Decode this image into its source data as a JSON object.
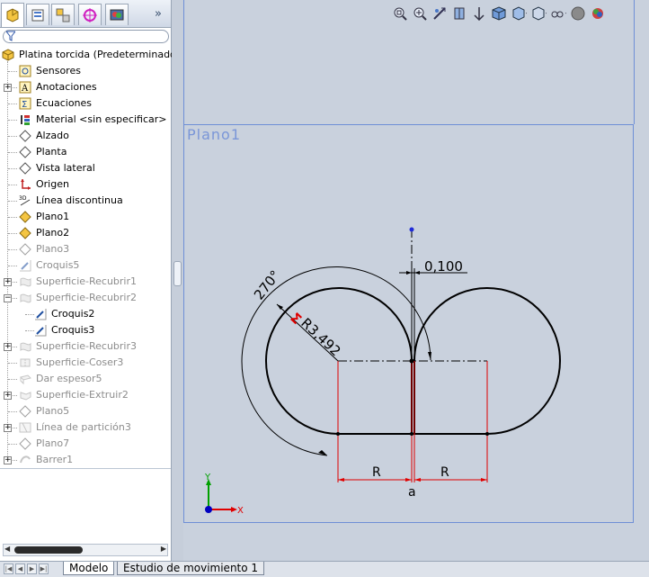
{
  "feature_manager": {
    "filter_icon": "filter-icon",
    "tabs": [
      {
        "name": "feature-manager-tab-icon"
      },
      {
        "name": "property-manager-tab-icon"
      },
      {
        "name": "configuration-manager-tab-icon"
      },
      {
        "name": "dimxpert-tab-icon"
      },
      {
        "name": "display-manager-tab-icon"
      }
    ],
    "collapse_glyph": "»",
    "root": {
      "label": "Platina torcida  (Predeterminado<<",
      "icon": "part-icon"
    },
    "items": [
      {
        "label": "Sensores",
        "icon": "sensor-icon",
        "dim": false,
        "expander": false
      },
      {
        "label": "Anotaciones",
        "icon": "annotation-icon",
        "dim": false,
        "expander": true
      },
      {
        "label": "Ecuaciones",
        "icon": "equation-icon",
        "dim": false,
        "expander": false
      },
      {
        "label": "Material <sin especificar>",
        "icon": "material-icon",
        "dim": false,
        "expander": false
      },
      {
        "label": "Alzado",
        "icon": "plane-icon",
        "dim": false,
        "expander": false
      },
      {
        "label": "Planta",
        "icon": "plane-icon",
        "dim": false,
        "expander": false
      },
      {
        "label": "Vista lateral",
        "icon": "plane-icon",
        "dim": false,
        "expander": false
      },
      {
        "label": "Origen",
        "icon": "origin-icon",
        "dim": false,
        "expander": false
      },
      {
        "label": "Línea discontinua",
        "icon": "3d-sketch-icon",
        "dim": false,
        "expander": false
      },
      {
        "label": "Plano1",
        "icon": "plane-yellow-icon",
        "dim": false,
        "expander": false
      },
      {
        "label": "Plano2",
        "icon": "plane-yellow-icon",
        "dim": false,
        "expander": false
      },
      {
        "label": "Plano3",
        "icon": "plane-icon",
        "dim": true,
        "expander": false
      },
      {
        "label": "Croquis5",
        "icon": "sketch-icon",
        "dim": true,
        "expander": false
      },
      {
        "label": "Superficie-Recubrir1",
        "icon": "surface-loft-icon",
        "dim": true,
        "expander": true
      },
      {
        "label": "Superficie-Recubrir2",
        "icon": "surface-loft-icon",
        "dim": true,
        "expander": true
      },
      {
        "label": "Croquis2",
        "icon": "sketch-icon",
        "dim": false,
        "expander": false,
        "child": true
      },
      {
        "label": "Croquis3",
        "icon": "sketch-icon",
        "dim": false,
        "expander": false,
        "child": true
      },
      {
        "label": "Superficie-Recubrir3",
        "icon": "surface-loft-icon",
        "dim": true,
        "expander": true
      },
      {
        "label": "Superficie-Coser3",
        "icon": "surface-knit-icon",
        "dim": true,
        "expander": false
      },
      {
        "label": "Dar espesor5",
        "icon": "thicken-icon",
        "dim": true,
        "expander": false
      },
      {
        "label": "Superficie-Extruir2",
        "icon": "surface-extrude-icon",
        "dim": true,
        "expander": true
      },
      {
        "label": "Plano5",
        "icon": "plane-icon",
        "dim": true,
        "expander": false
      },
      {
        "label": "Línea de partición3",
        "icon": "split-line-icon",
        "dim": true,
        "expander": true
      },
      {
        "label": "Plano7",
        "icon": "plane-icon",
        "dim": true,
        "expander": false
      },
      {
        "label": "Barrer1",
        "icon": "sweep-icon",
        "dim": true,
        "expander": true
      }
    ]
  },
  "heads_up_toolbar": [
    "zoom-to-fit-icon",
    "zoom-to-area-icon",
    "previous-view-icon",
    "section-view-icon",
    "dynamic-annotation-icon",
    "view-orientation-icon",
    "display-style-icon",
    "hide-show-items-icon",
    "edit-appearance-icon",
    "apply-scene-icon"
  ],
  "graphics": {
    "plane_label": "Plano1",
    "dim_angle": "270°",
    "dim_radius": "R3,492",
    "dim_gap": "0,100",
    "dim_r_left": "R",
    "dim_r_right": "R",
    "dim_point": "a",
    "sigma_glyph": "Σ",
    "triad_y": "Y",
    "triad_x": "X"
  },
  "bottom_tabs": {
    "modelo": "Modelo",
    "estudio": "Estudio de movimiento 1"
  },
  "colors": {
    "plane_border": "#6e8fd6",
    "sketch_line": "#000000",
    "dimension_red": "#e00000",
    "triad_green": "#00a000",
    "triad_red": "#e00000",
    "triad_blue": "#0000c0"
  }
}
